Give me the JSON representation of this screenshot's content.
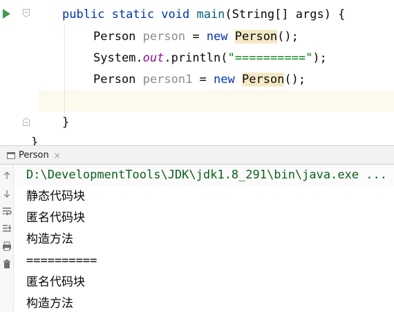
{
  "editor": {
    "lines": {
      "signature": {
        "kw1": "public static void ",
        "fn": "main",
        "rest": "(String[] args) {"
      },
      "line1": {
        "type": "Person ",
        "var": "person",
        "eq": " = ",
        "kw": "new ",
        "cls": "Person",
        "end": "();"
      },
      "line2": {
        "pre": "System.",
        "field": "out",
        "mid": ".println(",
        "str": "\"==========\"",
        "end": ");"
      },
      "line3": {
        "type": "Person ",
        "var": "person1",
        "eq": " = ",
        "kw": "new ",
        "cls": "Person",
        "end": "();"
      },
      "close1": "}",
      "close2": "}"
    }
  },
  "run_panel": {
    "tab_label": "Person",
    "tab_close": "×",
    "command": "D:\\DevelopmentTools\\JDK\\jdk1.8_291\\bin\\java.exe ...",
    "output": [
      "静态代码块",
      "匿名代码块",
      "构造方法",
      "==========",
      "匿名代码块",
      "构造方法"
    ]
  },
  "icons": {
    "run": "run-gutter-icon",
    "tools": [
      "rerun-up-icon",
      "down-icon",
      "soft-wrap-icon",
      "scroll-to-end-icon",
      "print-icon",
      "trash-icon"
    ]
  },
  "colors": {
    "keyword": "#0033b3",
    "method": "#00627a",
    "string": "#067d17",
    "field": "#871094",
    "unused_var": "#8a8a8a",
    "highlight": "#f5e9c5",
    "run_icon": "#3d9a50"
  }
}
